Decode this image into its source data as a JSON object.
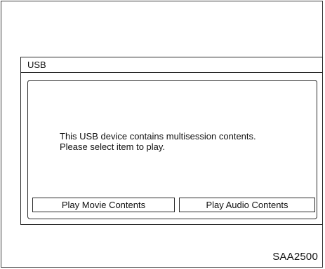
{
  "screen": {
    "title": "USB"
  },
  "dialog": {
    "message_line_1": "This USB device contains multisession contents.",
    "message_line_2": "Please select item to play."
  },
  "buttons": {
    "play_movie": "Play Movie Contents",
    "play_audio": "Play Audio Contents"
  },
  "figure": {
    "code": "SAA2500"
  }
}
